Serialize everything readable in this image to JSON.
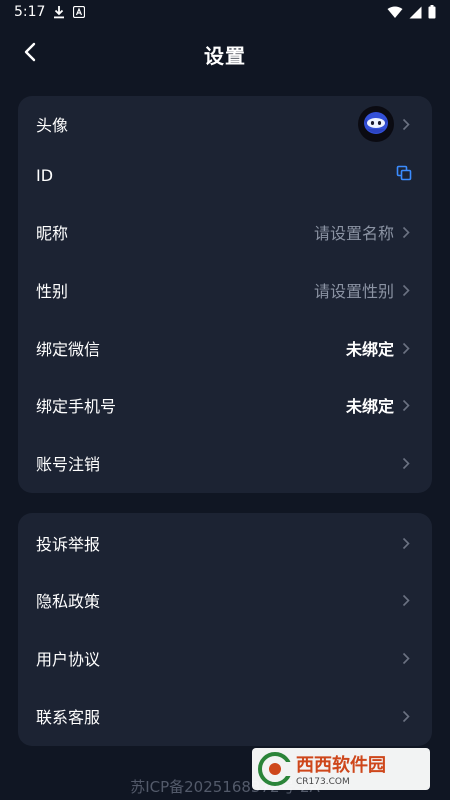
{
  "status_bar": {
    "time": "5:17",
    "icons": [
      "download-icon",
      "a-badge-icon",
      "wifi-icon",
      "signal-icon",
      "battery-icon"
    ]
  },
  "header": {
    "title": "设置",
    "back_icon": "chevron-left-icon"
  },
  "profile_section": {
    "rows": [
      {
        "label": "头像",
        "value": "",
        "type": "avatar"
      },
      {
        "label": "ID",
        "value": "",
        "type": "copy"
      },
      {
        "label": "昵称",
        "value": "请设置名称",
        "type": "placeholder"
      },
      {
        "label": "性别",
        "value": "请设置性别",
        "type": "placeholder"
      },
      {
        "label": "绑定微信",
        "value": "未绑定",
        "type": "status"
      },
      {
        "label": "绑定手机号",
        "value": "未绑定",
        "type": "status"
      },
      {
        "label": "账号注销",
        "value": "",
        "type": "link"
      }
    ]
  },
  "support_section": {
    "rows": [
      {
        "label": "投诉举报"
      },
      {
        "label": "隐私政策"
      },
      {
        "label": "用户协议"
      },
      {
        "label": "联系客服"
      }
    ]
  },
  "footer": {
    "icp": "苏ICP备2025168372号-2A"
  },
  "watermark": {
    "brand": "西西软件园",
    "url": "CR173.COM"
  },
  "colors": {
    "background": "#101623",
    "card": "#1c2333",
    "accent": "#3b8cff",
    "muted_text": "#8b93a3"
  }
}
